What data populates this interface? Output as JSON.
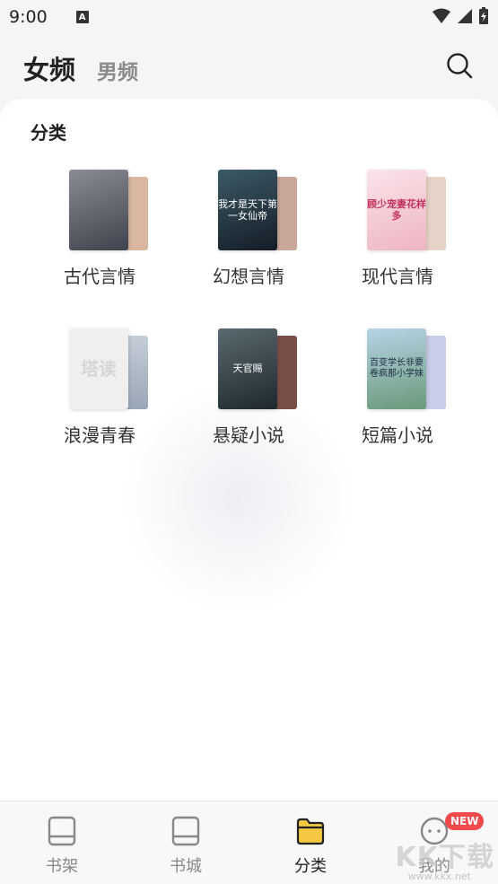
{
  "status_bar": {
    "time": "9:00",
    "notif_letter": "A"
  },
  "header": {
    "tab_female": "女频",
    "tab_male": "男频"
  },
  "section": {
    "title": "分类"
  },
  "categories": [
    {
      "label": "古代言情",
      "front_color": "#6b6f7a",
      "back_color": "#d9b7a0",
      "cover_text": ""
    },
    {
      "label": "幻想言情",
      "front_color": "#223344",
      "back_color": "#c9a79a",
      "cover_text": "我才是天下第一女仙帝"
    },
    {
      "label": "现代言情",
      "front_color": "#f3c8d0",
      "back_color": "#e6d2c6",
      "cover_text": "顾少宠妻花样多"
    },
    {
      "label": "浪漫青春",
      "front_color": "#efefef",
      "back_color": "#c5cdd8",
      "cover_text": "塔读"
    },
    {
      "label": "悬疑小说",
      "front_color": "#3a4a52",
      "back_color": "#7a4f4a",
      "cover_text": "天官赐"
    },
    {
      "label": "短篇小说",
      "front_color": "#8fb0c8",
      "back_color": "#c8cde8",
      "cover_text": "百变学长非要卷疯那小学妹"
    }
  ],
  "bottom_nav": [
    {
      "label": "书架",
      "icon": "bookshelf-icon"
    },
    {
      "label": "书城",
      "icon": "book-icon"
    },
    {
      "label": "分类",
      "icon": "folder-icon"
    },
    {
      "label": "我的",
      "icon": "chat-face-icon",
      "badge": "NEW"
    }
  ],
  "watermark": {
    "text": "KK下载",
    "sub": "www.kkx.net"
  },
  "colors": {
    "accent": "#f5c842",
    "badge": "#f04a4a"
  }
}
